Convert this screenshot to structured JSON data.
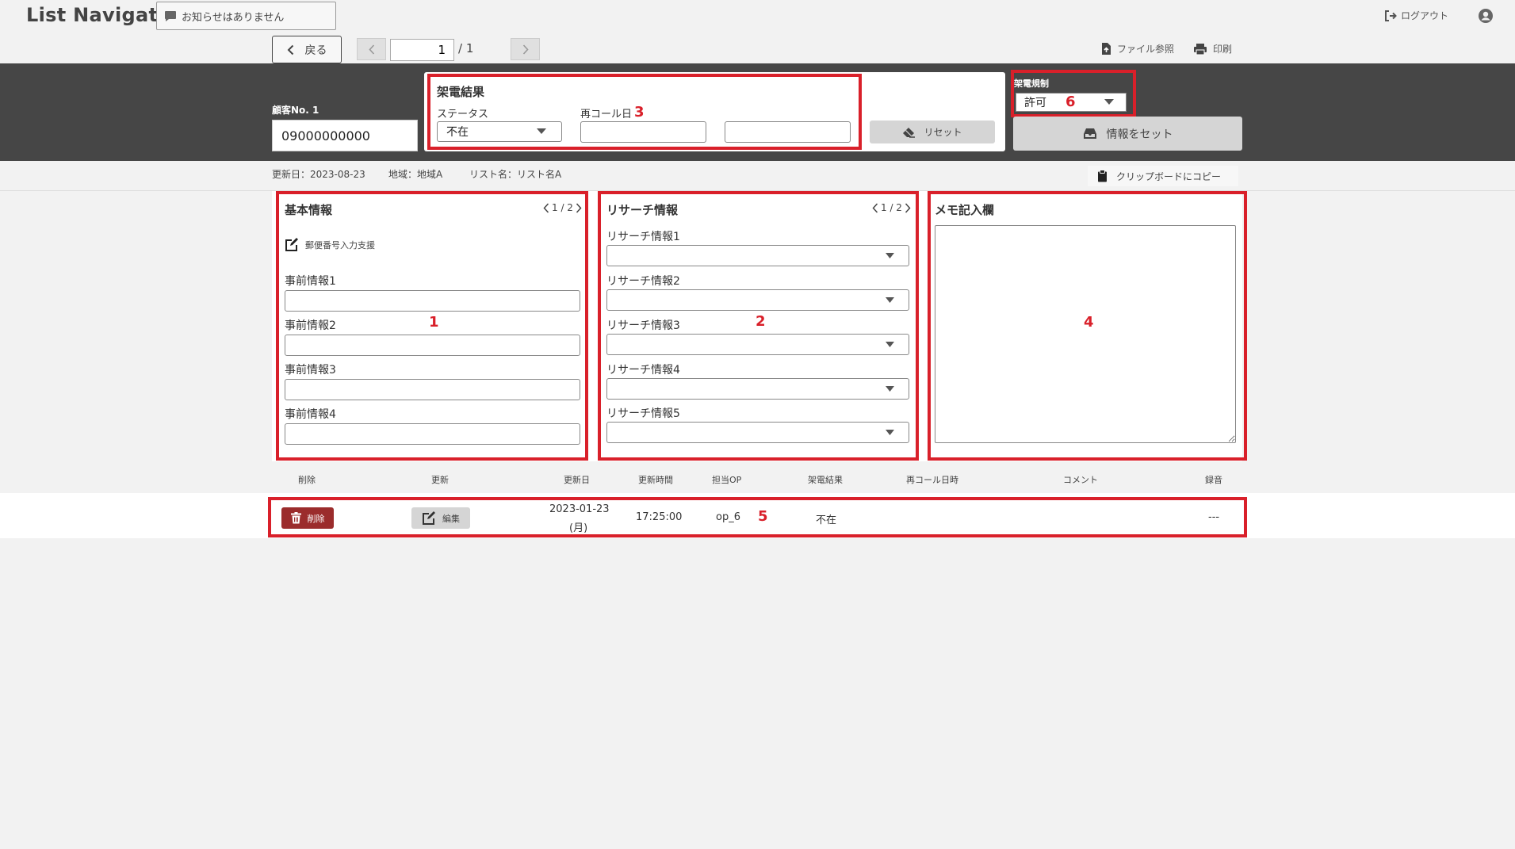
{
  "app": {
    "title": "List Navigator."
  },
  "header": {
    "notice": "お知らせはありません",
    "logout_label": "ログアウト"
  },
  "nav": {
    "back_label": "戻る",
    "page_current": "1",
    "page_total": "/ 1",
    "file_ref_label": "ファイル参照",
    "print_label": "印刷"
  },
  "customer": {
    "label": "顧客No. 1",
    "phone": "09000000000"
  },
  "call_result": {
    "title": "架電結果",
    "status_label": "ステータス",
    "status_value": "不在",
    "recall_label": "再コール日",
    "reset_label": "リセット"
  },
  "regulation": {
    "label": "架電規制",
    "value": "許可"
  },
  "set_info_label": "情報をセット",
  "meta": {
    "updated": "更新日：2023-08-23",
    "region": "地域：地域A",
    "list_name": "リスト名：リスト名A",
    "copy_label": "クリップボードにコピー"
  },
  "basic": {
    "title": "基本情報",
    "pager": "1 / 2",
    "zip_help": "郵便番号入力支援",
    "fields": [
      "事前情報1",
      "事前情報2",
      "事前情報3",
      "事前情報4"
    ]
  },
  "research": {
    "title": "リサーチ情報",
    "pager": "1 / 2",
    "fields": [
      "リサーチ情報1",
      "リサーチ情報2",
      "リサーチ情報3",
      "リサーチ情報4",
      "リサーチ情報5"
    ]
  },
  "memo": {
    "title": "メモ記入欄"
  },
  "history": {
    "headers": [
      "削除",
      "更新",
      "更新日",
      "更新時間",
      "担当OP",
      "架電結果",
      "再コール日時",
      "コメント",
      "録音"
    ],
    "rows": [
      {
        "delete_label": "削除",
        "edit_label": "編集",
        "date": "2023-01-23",
        "weekday": "(月)",
        "time": "17:25:00",
        "operator": "op_6",
        "result": "不在",
        "recall": "",
        "comment": "",
        "recording": "---"
      }
    ]
  },
  "annotations": [
    "1",
    "2",
    "3",
    "4",
    "5",
    "6"
  ],
  "colors": {
    "highlight": "#d9202a",
    "dark_band": "#464646",
    "delete_button": "#9b2c2c"
  }
}
